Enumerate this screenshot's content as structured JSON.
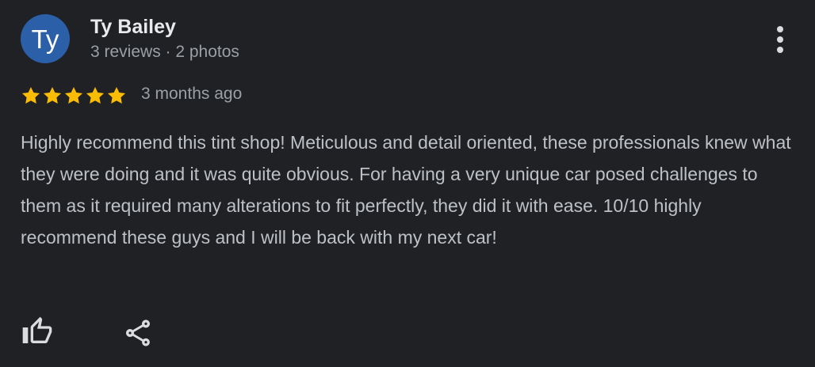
{
  "review": {
    "author": {
      "initials": "Ty",
      "name": "Ty Bailey",
      "meta": "3 reviews · 2 photos",
      "avatar_color": "#2b5fa8"
    },
    "rating": 5,
    "rating_max": 5,
    "date": "3 months ago",
    "text": "Highly recommend this tint shop! Meticulous and detail oriented, these professionals knew what they were doing and it was quite obvious. For having a very unique car posed challenges to them as it required many alterations to fit perfectly, they did it with ease. 10/10 highly recommend these guys and I will be back with my next car!",
    "actions": {
      "like_icon": "thumbs-up-icon",
      "share_icon": "share-icon",
      "more_icon": "more-vert-icon"
    }
  },
  "colors": {
    "background": "#202124",
    "star": "#fbbc04",
    "icon": "#dadce0",
    "name": "#e8eaed",
    "secondary_text": "#9aa0a6",
    "body_text": "#bdc1c6"
  }
}
